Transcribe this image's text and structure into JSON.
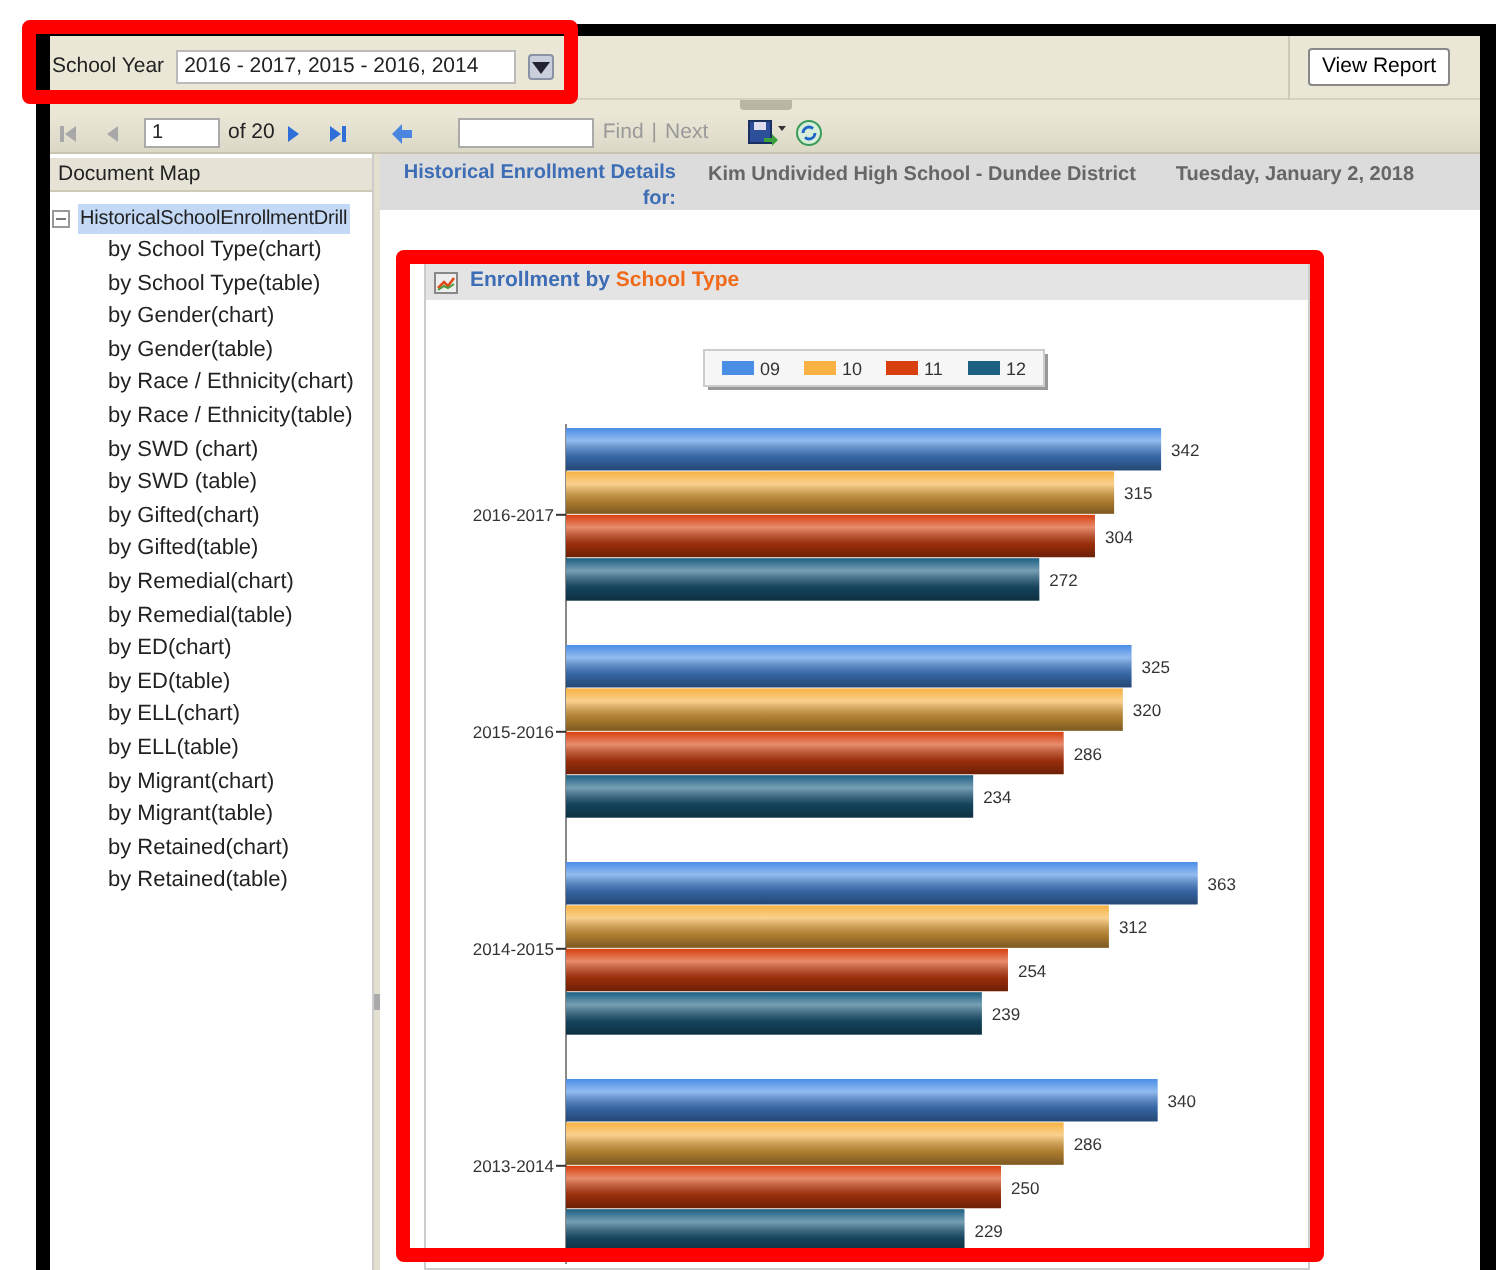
{
  "parameters": {
    "label": "School Year",
    "value": "2016 - 2017, 2015 - 2016, 2014",
    "highlighted": true
  },
  "view_report_button": "View Report",
  "toolbar": {
    "nav_buttons": [
      {
        "kind": "first",
        "disabled": true
      },
      {
        "kind": "prev",
        "disabled": true
      }
    ],
    "page": "1",
    "page_count": "of 20",
    "nav_buttons_after": [
      {
        "kind": "next",
        "disabled": false
      },
      {
        "kind": "last",
        "disabled": false
      }
    ],
    "find": {
      "label": "Find",
      "disabled": true
    },
    "separator": "|",
    "next": {
      "label": "Next",
      "disabled": true
    }
  },
  "document_map": {
    "title": "Document Map",
    "items": [
      {
        "label": "HistoricalSchoolEnrollmentDrill",
        "selected": true,
        "expanded": true,
        "children": [
          {
            "label": "by School Type(chart)",
            "selected": false
          },
          {
            "label": "by School Type(table)",
            "selected": false
          },
          {
            "label": "by Gender(chart)",
            "selected": false
          },
          {
            "label": "by Gender(table)",
            "selected": false
          },
          {
            "label": "by Race / Ethnicity(chart)",
            "selected": false
          },
          {
            "label": "by Race / Ethnicity(table)",
            "selected": false
          },
          {
            "label": "by SWD (chart)",
            "selected": false
          },
          {
            "label": "by SWD (table)",
            "selected": false
          },
          {
            "label": "by Gifted(chart)",
            "selected": false
          },
          {
            "label": "by Gifted(table)",
            "selected": false
          },
          {
            "label": "by Remedial(chart)",
            "selected": false
          },
          {
            "label": "by Remedial(table)",
            "selected": false
          },
          {
            "label": "by ED(chart)",
            "selected": false
          },
          {
            "label": "by ED(table)",
            "selected": false
          },
          {
            "label": "by ELL(chart)",
            "selected": false
          },
          {
            "label": "by ELL(table)",
            "selected": false
          },
          {
            "label": "by Migrant(chart)",
            "selected": false
          },
          {
            "label": "by Migrant(table)",
            "selected": false
          },
          {
            "label": "by Retained(chart)",
            "selected": false
          },
          {
            "label": "by Retained(table)",
            "selected": false
          }
        ]
      }
    ]
  },
  "report_header": {
    "label": "Historical Enrollment Details for:",
    "school": "Kim Undivided High School - Dundee District",
    "date": "Tuesday, January 2, 2018"
  },
  "chart_panel": {
    "title_parts": [
      {
        "text": "Enrollment by",
        "highlight": false
      },
      {
        "text": "School Type",
        "highlight": true
      }
    ],
    "highlighted": true,
    "chart_data": {
      "type": "bar",
      "orientation": "horizontal",
      "legend": "top",
      "categories": [
        "2016-2017",
        "2015-2016",
        "2014-2015",
        "2013-2014"
      ],
      "data_labels": true,
      "series": [
        {
          "name": "09",
          "color": "#4a8ee6",
          "values": [
            342,
            325,
            363,
            340
          ]
        },
        {
          "name": "10",
          "color": "#f7b243",
          "values": [
            315,
            320,
            312,
            286
          ]
        },
        {
          "name": "11",
          "color": "#d8400e",
          "values": [
            304,
            286,
            254,
            250
          ]
        },
        {
          "name": "12",
          "color": "#1d5f82",
          "values": [
            272,
            234,
            239,
            229
          ]
        }
      ]
    }
  }
}
